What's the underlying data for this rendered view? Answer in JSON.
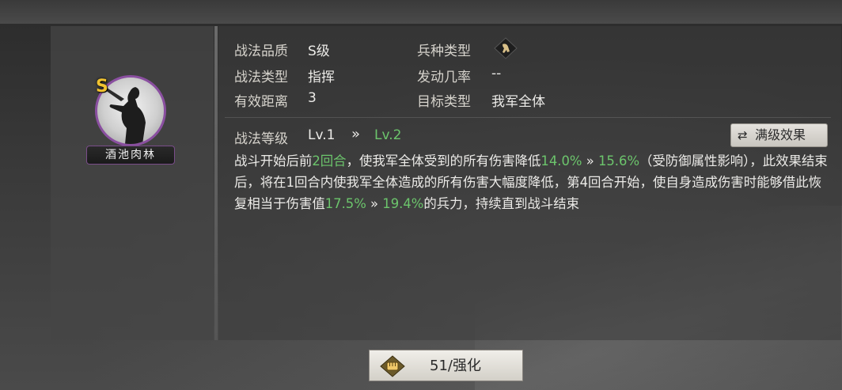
{
  "hero": {
    "grade": "S",
    "name": "酒池肉林"
  },
  "info": {
    "quality_label": "战法品质",
    "quality_value": "S级",
    "arm_type_label": "兵种类型",
    "arm_type_icon": "cavalry-emblem-icon",
    "type_label": "战法类型",
    "type_value": "指挥",
    "rate_label": "发动几率",
    "rate_value": "--",
    "range_label": "有效距离",
    "range_value": "3",
    "target_label": "目标类型",
    "target_value": "我军全体"
  },
  "level": {
    "label": "战法等级",
    "current": "Lv.1",
    "arrow": "»",
    "next": "Lv.2",
    "max_button": "满级效果"
  },
  "description": {
    "p1": "战斗开始后前",
    "rounds": "2回合",
    "p2": "，使我军全体受到的所有伤害降低",
    "dmg_cur": "14.0%",
    "arrow1": " » ",
    "dmg_next": "15.6%",
    "p3": "（受防御属性影响），此效果结束后，将在1回合内使我军全体造成的所有伤害大幅度降低，第4回合开始，使自身造成伤害时能够借此恢复相当于伤害值",
    "heal_cur": "17.5%",
    "arrow2": " » ",
    "heal_next": "19.4%",
    "p4": "的兵力，持续直到战斗结束"
  },
  "enhance": {
    "label": "51/强化"
  },
  "colors": {
    "accent_green": "#6cc56c",
    "grade_gold": "#f0c230",
    "frame_purple": "#8a4fa0"
  }
}
